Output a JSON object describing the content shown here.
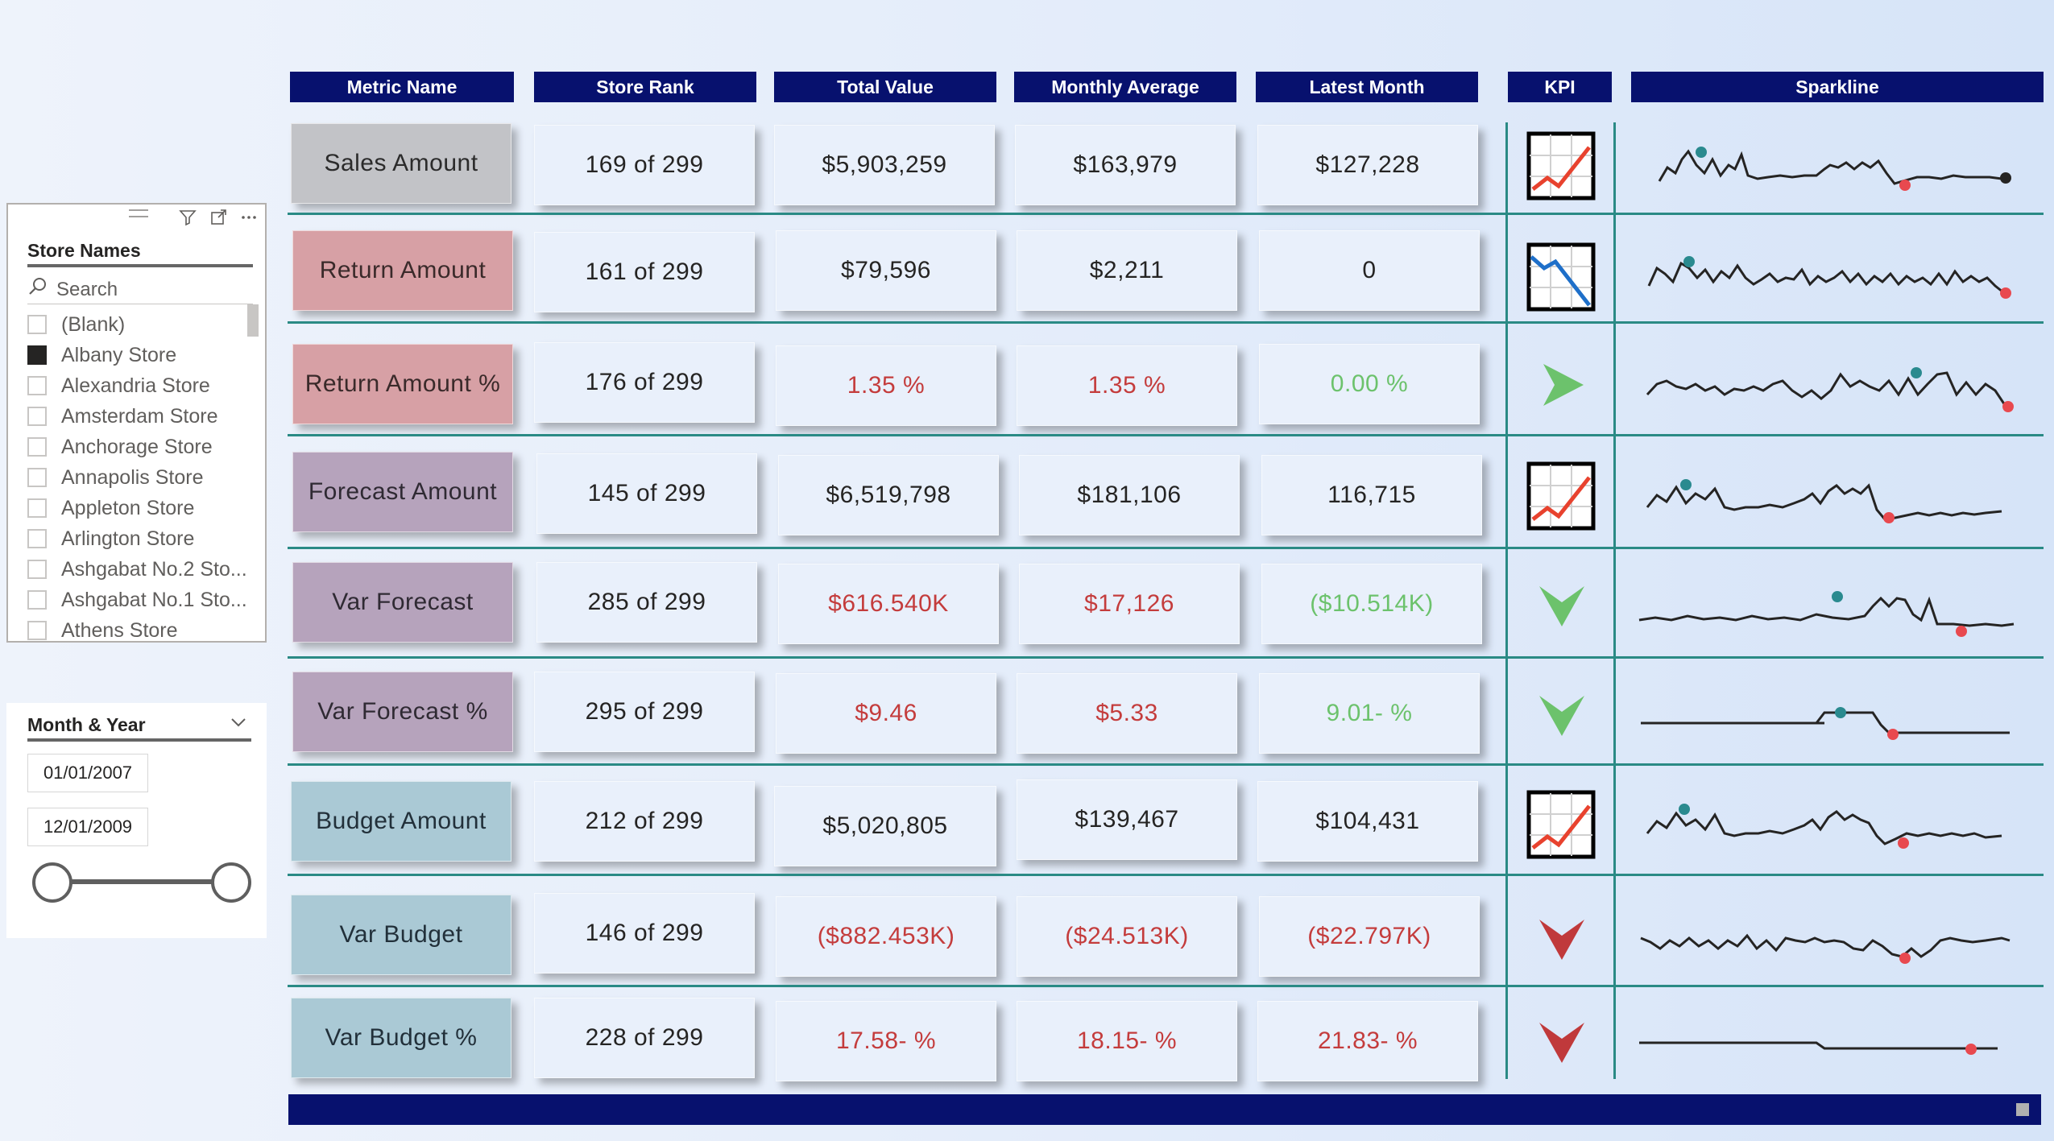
{
  "store_slicer": {
    "title": "Store Names",
    "search_placeholder": "Search",
    "items": [
      {
        "label": "(Blank)",
        "checked": false
      },
      {
        "label": "Albany Store",
        "checked": true
      },
      {
        "label": "Alexandria Store",
        "checked": false
      },
      {
        "label": "Amsterdam Store",
        "checked": false
      },
      {
        "label": "Anchorage Store",
        "checked": false
      },
      {
        "label": "Annapolis Store",
        "checked": false
      },
      {
        "label": "Appleton Store",
        "checked": false
      },
      {
        "label": "Arlington Store",
        "checked": false
      },
      {
        "label": "Ashgabat No.2 Sto...",
        "checked": false
      },
      {
        "label": "Ashgabat No.1 Sto...",
        "checked": false
      },
      {
        "label": "Athens Store",
        "checked": false
      }
    ]
  },
  "date_slicer": {
    "title": "Month & Year",
    "start": "01/01/2007",
    "end": "12/01/2009"
  },
  "headers": {
    "metric": "Metric Name",
    "rank": "Store Rank",
    "total": "Total Value",
    "monthly": "Monthly Average",
    "latest": "Latest Month",
    "kpi": "KPI",
    "sparkline": "Sparkline"
  },
  "rows": [
    {
      "metric": "Sales Amount",
      "rank": "169 of 299",
      "total": "$5,903,259",
      "monthly": "$163,979",
      "latest": "$127,228",
      "kpi": "chart-up-icon"
    },
    {
      "metric": "Return Amount",
      "rank": "161 of 299",
      "total": "$79,596",
      "monthly": "$2,211",
      "latest": "0",
      "kpi": "chart-down-icon"
    },
    {
      "metric": "Return Amount %",
      "rank": "176 of 299",
      "total": "1.35 %",
      "monthly": "1.35 %",
      "latest": "0.00 %",
      "kpi": "arrow-right-icon"
    },
    {
      "metric": "Forecast Amount",
      "rank": "145 of 299",
      "total": "$6,519,798",
      "monthly": "$181,106",
      "latest": "116,715",
      "kpi": "chart-up-icon"
    },
    {
      "metric": "Var Forecast",
      "rank": "285 of 299",
      "total": "$616.540K",
      "monthly": "$17,126",
      "latest": "($10.514K)",
      "kpi": "chevron-down-green-icon"
    },
    {
      "metric": "Var Forecast %",
      "rank": "295 of 299",
      "total": "$9.46",
      "monthly": "$5.33",
      "latest": "9.01- %",
      "kpi": "chevron-down-green-icon"
    },
    {
      "metric": "Budget Amount",
      "rank": "212 of 299",
      "total": "$5,020,805",
      "monthly": "$139,467",
      "latest": "$104,431",
      "kpi": "chart-up-icon"
    },
    {
      "metric": "Var Budget",
      "rank": "146 of 299",
      "total": "($882.453K)",
      "monthly": "($24.513K)",
      "latest": "($22.797K)",
      "kpi": "chevron-down-red-icon"
    },
    {
      "metric": "Var Budget %",
      "rank": "228 of 299",
      "total": "17.58- %",
      "monthly": "18.15- %",
      "latest": "21.83- %",
      "kpi": "chevron-down-red-icon"
    }
  ],
  "colors": {
    "header_bg": "#07116e",
    "teal_line": "#2a8a85",
    "red_text": "#c43c3c",
    "green_text": "#6cc26c",
    "spark_high": "#2a8a8f",
    "spark_low": "#e8494f"
  }
}
